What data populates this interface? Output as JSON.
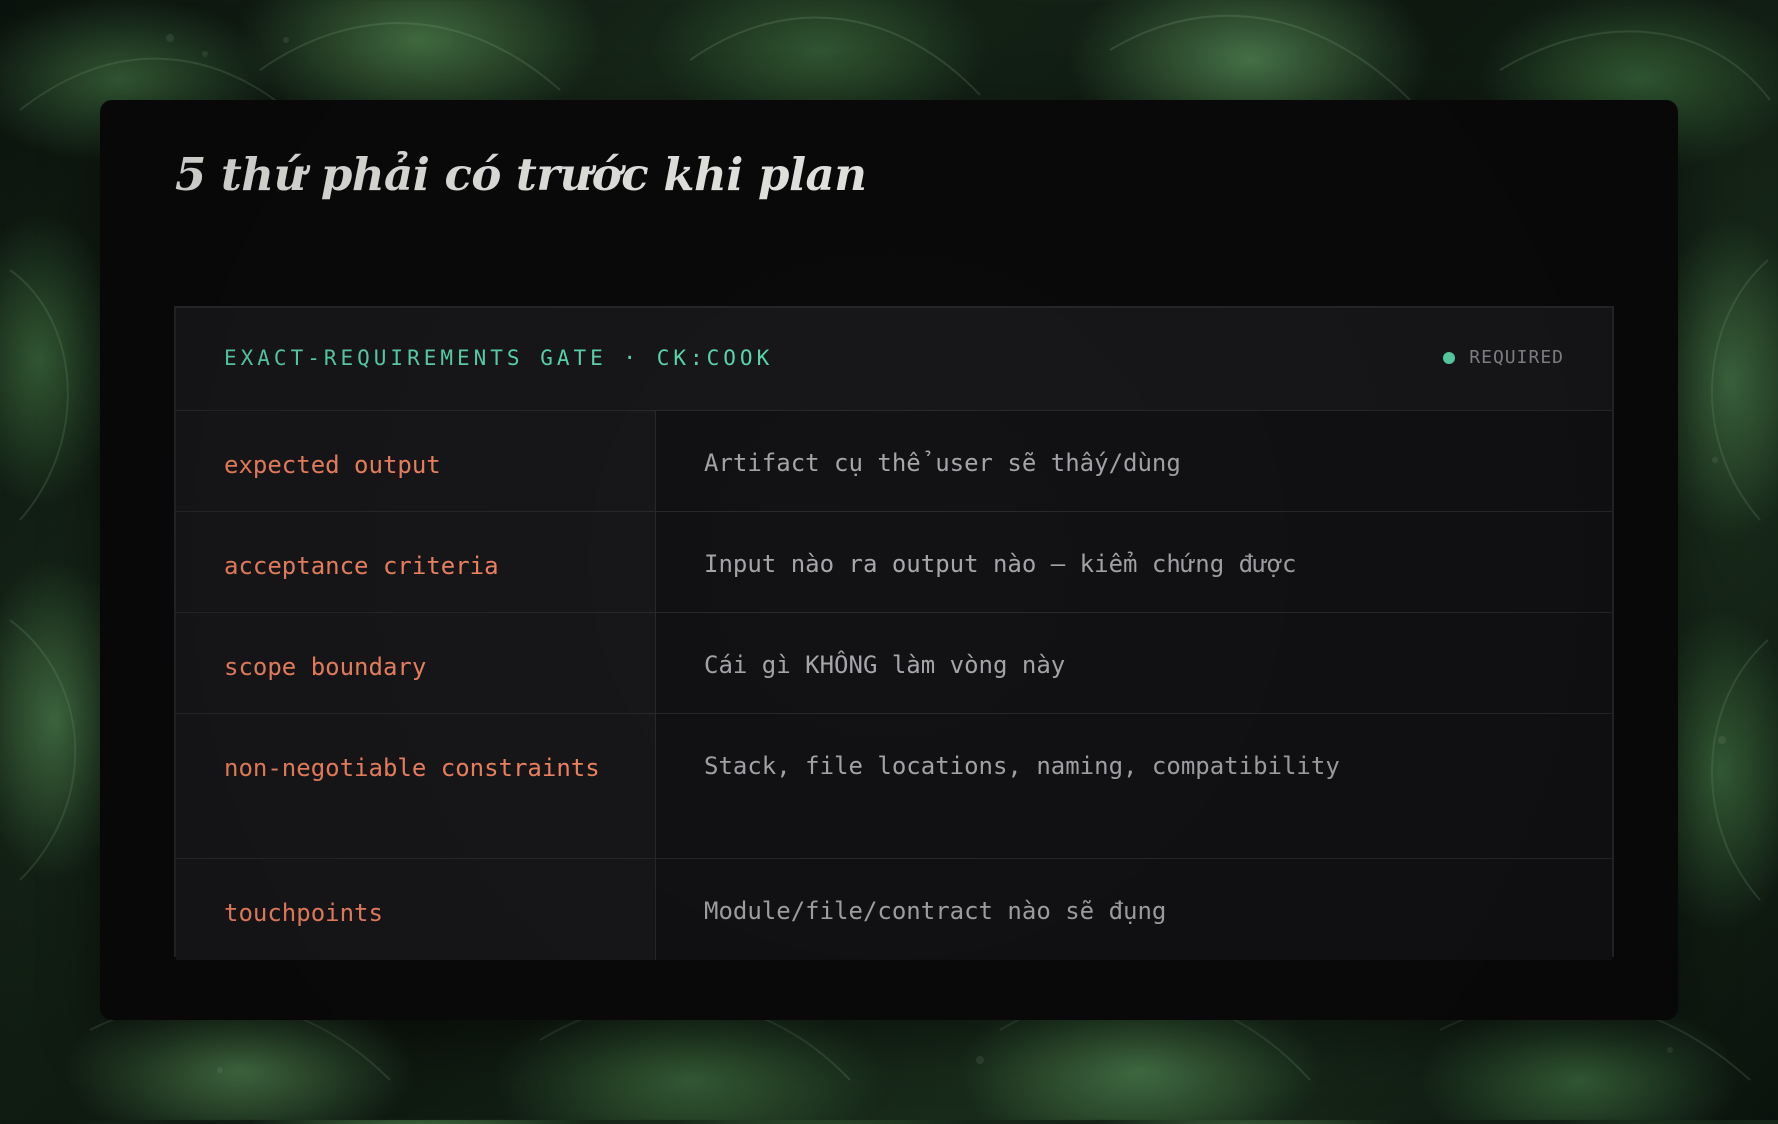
{
  "title": "5 thứ phải có trước khi plan",
  "panel": {
    "header_label": "EXACT-REQUIREMENTS GATE · CK:COOK",
    "status_label": "REQUIRED"
  },
  "rows": [
    {
      "label": "expected output",
      "description": "Artifact cụ thể user sẽ thấy/dùng"
    },
    {
      "label": "acceptance criteria",
      "description": "Input nào ra output nào — kiểm chứng được"
    },
    {
      "label": "scope boundary",
      "description": "Cái gì KHÔNG làm vòng này"
    },
    {
      "label": "non-negotiable constraints",
      "description": "Stack, file locations, naming, compatibility"
    },
    {
      "label": "touchpoints",
      "description": "Module/file/contract nào sẽ đụng"
    }
  ],
  "colors": {
    "accent_teal": "#5fe0b2",
    "accent_orange": "#ff8b66",
    "text_muted": "#a9a9ad",
    "card_bg": "#0a0a0b"
  },
  "icons": {
    "status": "green-dot-icon"
  }
}
